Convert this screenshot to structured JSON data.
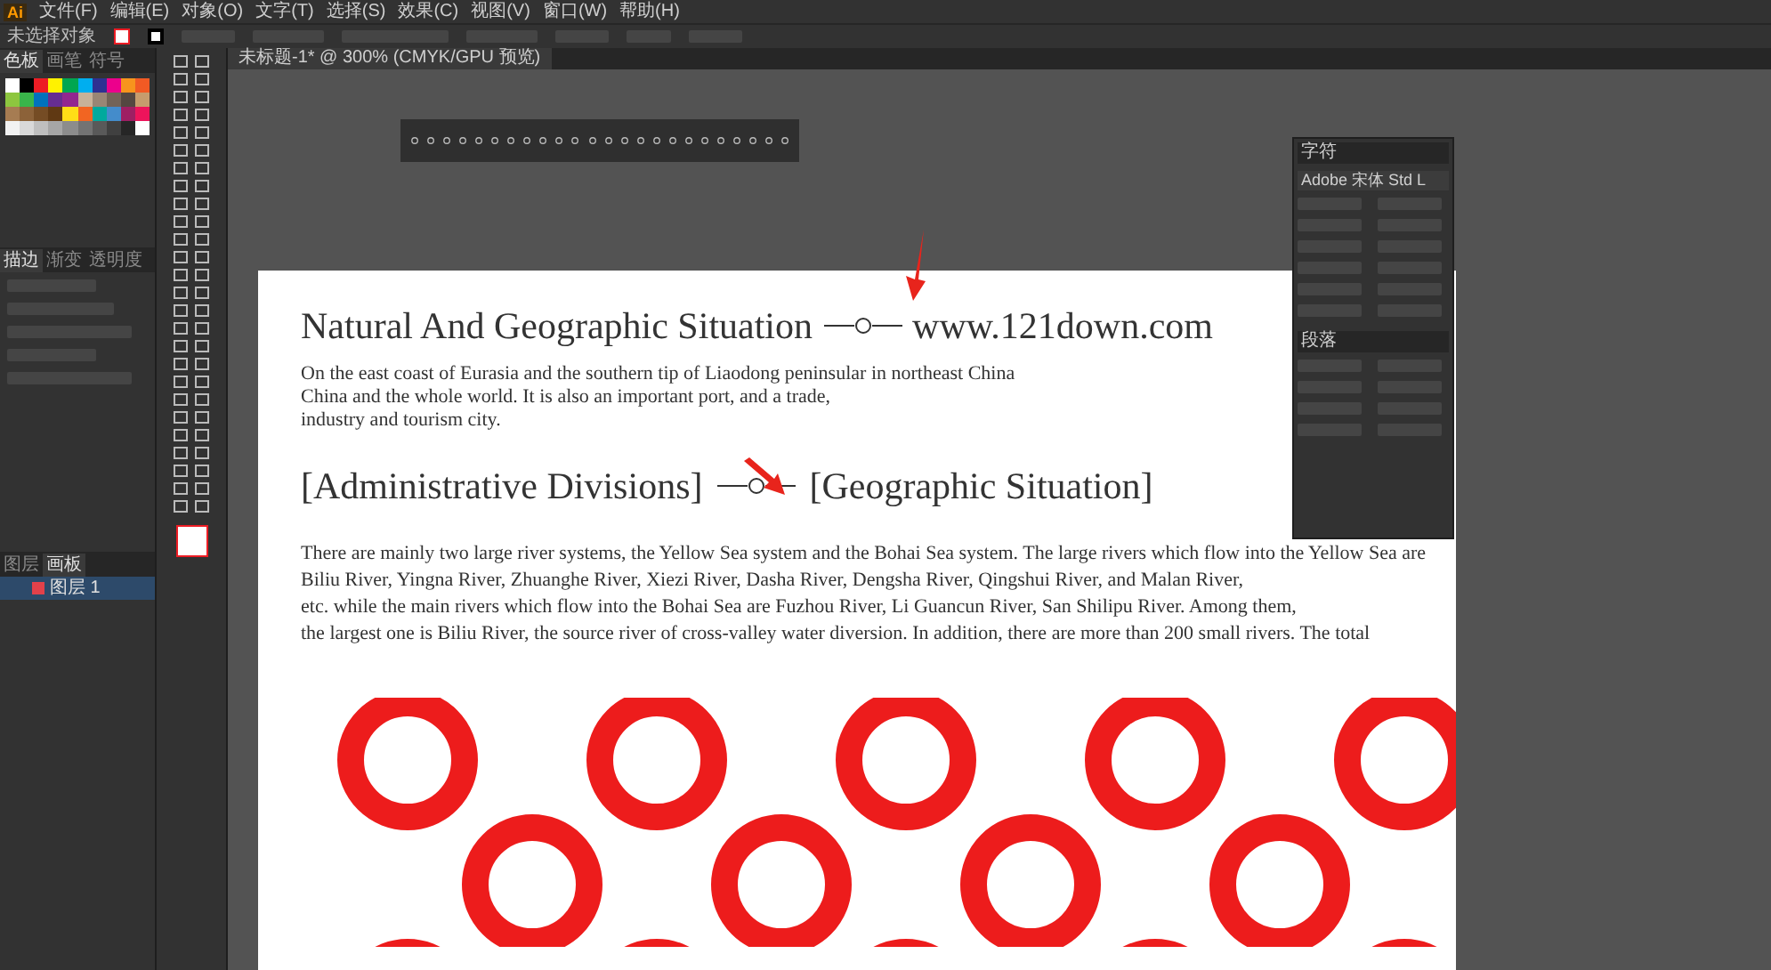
{
  "app_logo": "Ai",
  "menu": [
    "文件(F)",
    "编辑(E)",
    "对象(O)",
    "文字(T)",
    "选择(S)",
    "效果(C)",
    "视图(V)",
    "窗口(W)",
    "帮助(H)"
  ],
  "control_bar": {
    "selection": "未选择对象"
  },
  "document_tab": {
    "title": "未标题-1* @ 300% (CMYK/GPU 预览)"
  },
  "swatches_panel": {
    "tabs": [
      {
        "label": "色板",
        "selected": true
      },
      {
        "label": "画笔",
        "selected": false
      },
      {
        "label": "符号",
        "selected": false
      }
    ]
  },
  "stroke_panel": {
    "tabs": [
      {
        "label": "描边",
        "selected": true
      },
      {
        "label": "渐变",
        "selected": false
      },
      {
        "label": "透明度",
        "selected": false
      }
    ]
  },
  "layers_panel": {
    "tabs": [
      {
        "label": "图层",
        "selected": false
      },
      {
        "label": "画板",
        "selected": true
      }
    ],
    "layers": [
      {
        "name": "图层 1",
        "selected": true
      }
    ]
  },
  "character_panel": {
    "title": "字符",
    "font": "Adobe 宋体 Std L",
    "paragraph_title": "段落"
  },
  "artboard": {
    "title": "Natural And Geographic Situation",
    "url": "www.121down.com",
    "intro_lines": [
      "On the east coast of Eurasia and the southern tip of Liaodong peninsular in northeast China",
      "China and the whole world. It is also an important port, and a trade,",
      "industry and tourism city."
    ],
    "heading_left": "[Administrative Divisions]",
    "heading_right": "[Geographic Situation]",
    "body_lines": [
      "There are mainly two large river systems, the Yellow Sea system and the Bohai Sea system. The large rivers which flow into the Yellow Sea are",
      "Biliu River, Yingna River, Zhuanghe River, Xiezi River, Dasha River, Dengsha River, Qingshui River, and Malan River,",
      "etc. while the main rivers which flow into the Bohai Sea are Fuzhou River, Li Guancun River, San Shilipu River. Among them,",
      "the largest one is Biliu River, the source river of cross-valley water diversion. In addition, there are more than 200 small rivers. The total"
    ]
  }
}
